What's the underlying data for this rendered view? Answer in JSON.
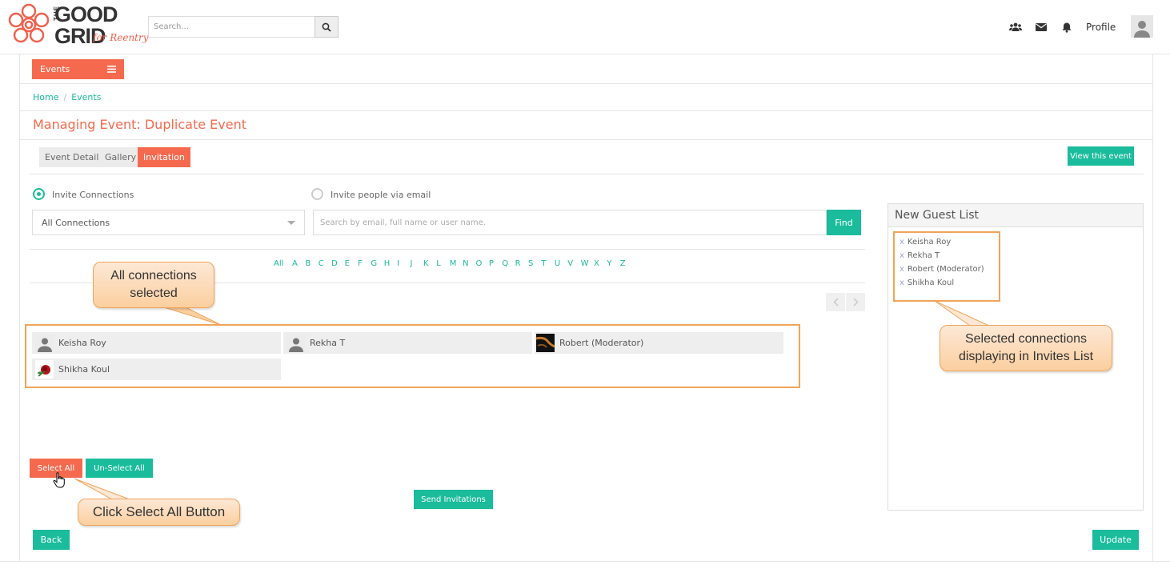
{
  "header": {
    "logo": {
      "line1": "GOOD",
      "the": "THE",
      "line2": "GRID",
      "tagline": "for Reentry"
    },
    "search_placeholder": "Search...",
    "icons": [
      "users-icon",
      "envelope-icon",
      "bell-icon"
    ],
    "profile_label": "Profile"
  },
  "nav": {
    "events_label": "Events"
  },
  "breadcrumb": {
    "home": "Home",
    "separator": "/",
    "current": "Events"
  },
  "page_title": "Managing Event: Duplicate Event",
  "tabs": [
    {
      "label": "Event Details",
      "active": false
    },
    {
      "label": "Gallery",
      "active": false
    },
    {
      "label": "Invitation",
      "active": true
    }
  ],
  "view_event_label": "View this event",
  "invite": {
    "option_connections": "Invite Connections",
    "option_email": "Invite people via email",
    "selected_option": "Invite Connections",
    "connections_select_value": "All Connections",
    "search_placeholder": "Search by email, full name or user name.",
    "find_label": "Find"
  },
  "alphabet": [
    "All",
    "A",
    "B",
    "C",
    "D",
    "E",
    "F",
    "G",
    "H",
    "I",
    "J",
    "K",
    "L",
    "M",
    "N",
    "O",
    "P",
    "Q",
    "R",
    "S",
    "T",
    "U",
    "V",
    "W",
    "X",
    "Y",
    "Z"
  ],
  "connections": [
    {
      "name": "Keisha Roy",
      "avatar": "default-avatar"
    },
    {
      "name": "Rekha T",
      "avatar": "default-avatar"
    },
    {
      "name": "Robert (Moderator)",
      "avatar": "photo-avatar"
    },
    {
      "name": "Shikha Koul",
      "avatar": "rose-avatar"
    }
  ],
  "buttons": {
    "select_all": "Select All",
    "unselect_all": "Un-Select All",
    "send_invitations": "Send Invitations",
    "back": "Back",
    "update": "Update"
  },
  "guest_list": {
    "title": "New Guest List",
    "remove_glyph": "x",
    "items": [
      "Keisha Roy",
      "Rekha T",
      "Robert (Moderator)",
      "Shikha Koul"
    ]
  },
  "callouts": {
    "all_selected": "All connections selected",
    "all_selected_line1": "All connections",
    "all_selected_line2": "selected",
    "select_all": "Click Select All Button",
    "guests_line1": "Selected connections",
    "guests_line2": "displaying in Invites List"
  },
  "colors": {
    "accent_orange": "#f56a4f",
    "accent_teal": "#1abc9c",
    "callout_border": "#f0a45a"
  }
}
